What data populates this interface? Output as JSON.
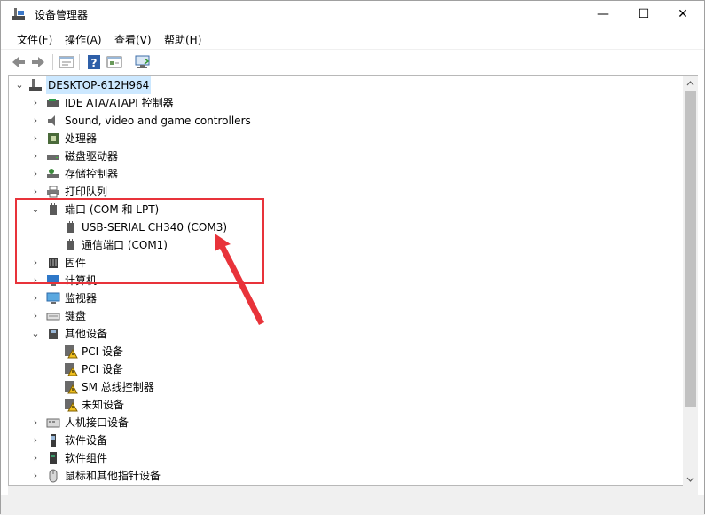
{
  "window": {
    "title": "设备管理器",
    "minimize": "—",
    "maximize": "☐",
    "close": "✕"
  },
  "menu": [
    "文件(F)",
    "操作(A)",
    "查看(V)",
    "帮助(H)"
  ],
  "tree": {
    "root": "DESKTOP-612H964",
    "items": [
      {
        "label": "IDE ATA/ATAPI 控制器",
        "icon": "ide-controller-icon",
        "expanded": false
      },
      {
        "label": "Sound, video and game controllers",
        "icon": "speaker-icon",
        "expanded": false
      },
      {
        "label": "处理器",
        "icon": "cpu-icon",
        "expanded": false
      },
      {
        "label": "磁盘驱动器",
        "icon": "disk-drive-icon",
        "expanded": false
      },
      {
        "label": "存储控制器",
        "icon": "storage-controller-icon",
        "expanded": false
      },
      {
        "label": "打印队列",
        "icon": "printer-icon",
        "expanded": false
      },
      {
        "label": "端口 (COM 和 LPT)",
        "icon": "port-icon",
        "expanded": true,
        "children": [
          "USB-SERIAL CH340 (COM3)",
          "通信端口 (COM1)"
        ]
      },
      {
        "label": "固件",
        "icon": "firmware-icon",
        "expanded": false
      },
      {
        "label": "计算机",
        "icon": "computer-icon",
        "expanded": false
      },
      {
        "label": "监视器",
        "icon": "monitor-icon",
        "expanded": false
      },
      {
        "label": "键盘",
        "icon": "keyboard-icon",
        "expanded": false
      },
      {
        "label": "其他设备",
        "icon": "other-devices-icon",
        "expanded": true,
        "children": [
          "PCI 设备",
          "PCI 设备",
          "SM 总线控制器",
          "未知设备"
        ]
      },
      {
        "label": "人机接口设备",
        "icon": "hid-icon",
        "expanded": false
      },
      {
        "label": "软件设备",
        "icon": "software-device-icon",
        "expanded": false
      },
      {
        "label": "软件组件",
        "icon": "software-component-icon",
        "expanded": false
      },
      {
        "label": "鼠标和其他指针设备",
        "icon": "mouse-icon",
        "expanded": false
      }
    ]
  },
  "colors": {
    "highlight": "#e8333a",
    "selection": "#cce8ff"
  }
}
